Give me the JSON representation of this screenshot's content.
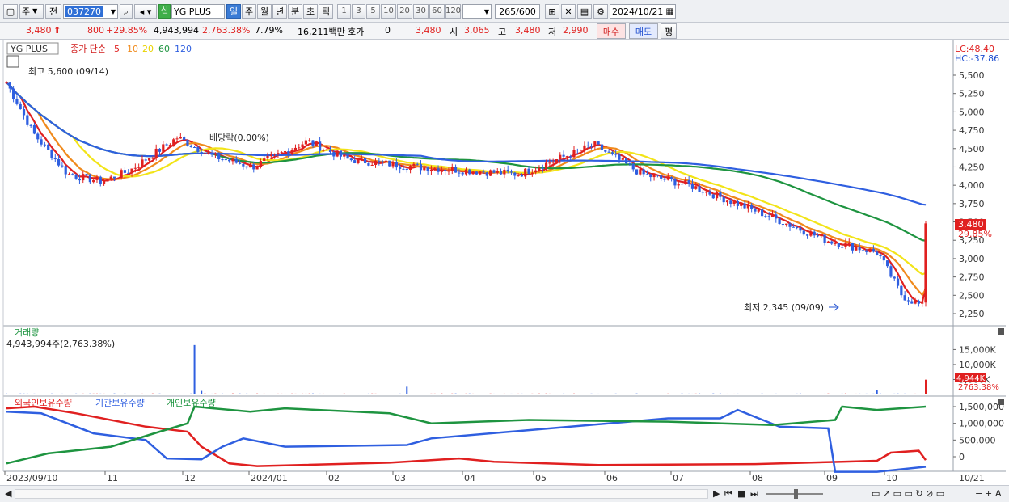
{
  "toolbar": {
    "period_label": "주",
    "prev_label": "전",
    "code": "037270",
    "credit_badge": "신",
    "stock_name": "YG PLUS",
    "periods": [
      "일",
      "주",
      "월",
      "년",
      "분",
      "초",
      "틱"
    ],
    "active_period": "일",
    "minutes": [
      "1",
      "3",
      "5",
      "10",
      "20",
      "30",
      "60",
      "120"
    ],
    "count_display": "265",
    "count_max": "/600",
    "date": "2024/10/21"
  },
  "quote": {
    "price": "3,480",
    "change": "800",
    "change_pct": "+29.85%",
    "volume": "4,943,994",
    "volume_ratio": "2,763.38%",
    "turnover": "7.79%",
    "amount": "16,211백만",
    "hoga_label": "호가",
    "hoga_value": "0",
    "hoga_price": "3,480",
    "open_label": "시",
    "open": "3,065",
    "high_label": "고",
    "high": "3,480",
    "low_label": "저",
    "low": "2,990",
    "buy_label": "매수",
    "sell_label": "매도",
    "avg_label": "평"
  },
  "price_panel": {
    "name_box": "YG PLUS",
    "ma_title": "종가 단순",
    "ma_periods": [
      "5",
      "10",
      "20",
      "60",
      "120"
    ],
    "ma_colors": [
      "#e02020",
      "#f08a1c",
      "#f2e418",
      "#1e9440",
      "#2f5fe0"
    ],
    "lc": "LC:48.40",
    "hc": "HC:-37.86",
    "high_note": "최고 5,600 (09/14)",
    "low_note": "최저 2,345 (09/09)",
    "event_note": "배당락(0.00%)",
    "axis_ticks": [
      "5,500",
      "5,250",
      "5,000",
      "4,750",
      "4,500",
      "4,250",
      "4,000",
      "3,750",
      "3,500",
      "3,250",
      "3,000",
      "2,750",
      "2,500",
      "2,250"
    ],
    "current_tag": "3,480",
    "current_pct_tag": "29.85%"
  },
  "volume_panel": {
    "title": "거래량",
    "subtitle": "4,943,994주(2,763.38%)",
    "axis_ticks": [
      "15,000K",
      "10,000K",
      "5,000K"
    ],
    "current_tag": "4,944K",
    "current_pct_tag": "2763.38%"
  },
  "holding_panel": {
    "legend": [
      {
        "label": "외국인보유수량",
        "color": "#e02020"
      },
      {
        "label": "기관보유수량",
        "color": "#2f5fe0"
      },
      {
        "label": "개인보유수량",
        "color": "#1e9440"
      }
    ],
    "axis_ticks": [
      "1,500,000",
      "1,000,000",
      "500,000",
      "0"
    ]
  },
  "date_axis": [
    "2023/09/10",
    "11",
    "12",
    "2024/01",
    "02",
    "03",
    "04",
    "05",
    "06",
    "07",
    "08",
    "09",
    "10"
  ],
  "date_axis_end": "10/21"
}
